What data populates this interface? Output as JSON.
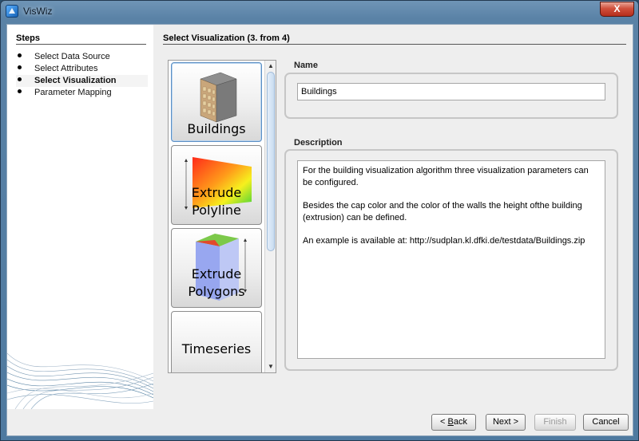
{
  "window": {
    "title": "VisWiz",
    "close_label": "X"
  },
  "steps": {
    "title": "Steps",
    "items": [
      {
        "label": "Select Data Source"
      },
      {
        "label": "Select Attributes"
      },
      {
        "label": "Select Visualization"
      },
      {
        "label": "Parameter Mapping"
      }
    ],
    "active_index": 2
  },
  "main": {
    "title": "Select Visualization (3. from 4)",
    "gallery": {
      "items": [
        {
          "label": "Buildings",
          "icon": "building-icon"
        },
        {
          "label_line1": "Extrude",
          "label_line2": "Polyline",
          "icon": "extrude-polyline-icon"
        },
        {
          "label_line1": "Extrude",
          "label_line2": "Polygons",
          "icon": "extrude-polygons-icon"
        },
        {
          "label": "Timeseries"
        }
      ],
      "selected_index": 0
    },
    "name": {
      "label": "Name",
      "value": "Buildings"
    },
    "description": {
      "label": "Description",
      "paragraphs": [
        "For the building visualization algorithm three visualization parameters can be configured.",
        "Besides the cap color and the color of the walls the height ofthe building (extrusion) can be defined.",
        "An example is available at: http://sudplan.kl.dfki.de/testdata/Buildings.zip"
      ]
    }
  },
  "buttons": {
    "back_prefix": "< ",
    "back_mnemonic": "B",
    "back_rest": "ack",
    "next": "Next >",
    "finish": "Finish",
    "cancel": "Cancel"
  },
  "colors": {
    "accent": "#5b8fc4",
    "titlebar": "#5a82a6",
    "close": "#c7402c"
  }
}
